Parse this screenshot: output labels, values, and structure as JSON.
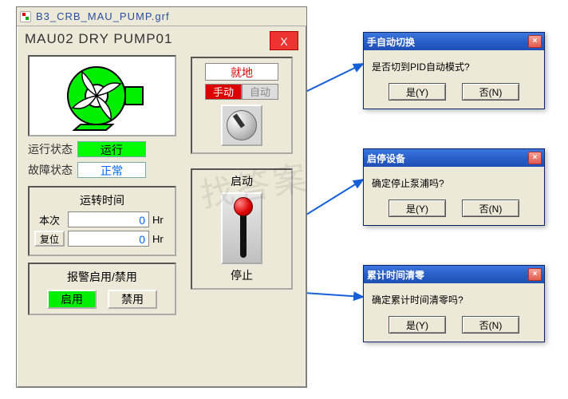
{
  "window": {
    "filename": "B3_CRB_MAU_PUMP.grf",
    "title": "MAU02 DRY PUMP01",
    "close_glyph": "X"
  },
  "status": {
    "run_label": "运行状态",
    "run_value": "运行",
    "fault_label": "故障状态",
    "fault_value": "正常"
  },
  "runtime": {
    "title": "运转时间",
    "current_label": "本次",
    "current_value": "0",
    "current_unit": "Hr",
    "reset_button": "复位",
    "total_value": "0",
    "total_unit": "Hr"
  },
  "alarm": {
    "title": "报警启用/禁用",
    "enable": "启用",
    "disable": "禁用"
  },
  "mode": {
    "location": "就地",
    "manual": "手动",
    "auto": "自动"
  },
  "startstop": {
    "start": "启动",
    "stop": "停止"
  },
  "dialogs": {
    "d1": {
      "title": "手自动切换",
      "msg": "是否切到PID自动模式?",
      "yes": "是(Y)",
      "no": "否(N)"
    },
    "d2": {
      "title": "启停设备",
      "msg": "确定停止泵浦吗?",
      "yes": "是(Y)",
      "no": "否(N)"
    },
    "d3": {
      "title": "累计时间清零",
      "msg": "确定累计时间清零吗?",
      "yes": "是(Y)",
      "no": "否(N)"
    }
  },
  "xp_close_glyph": "×"
}
